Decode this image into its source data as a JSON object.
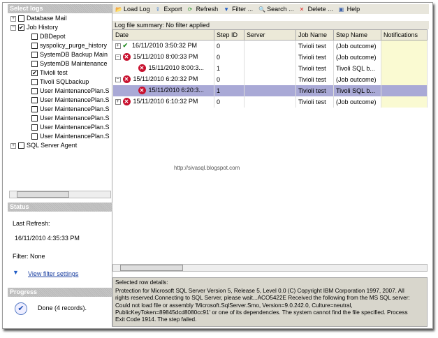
{
  "left": {
    "select_logs": "Select logs",
    "tree": [
      {
        "label": "Database Mail",
        "level": 0,
        "expander": "+",
        "checked": false
      },
      {
        "label": "Job History",
        "level": 0,
        "expander": "-",
        "checked": true
      },
      {
        "label": "DBDepot",
        "level": 1,
        "checked": false
      },
      {
        "label": "syspolicy_purge_history",
        "level": 1,
        "checked": false
      },
      {
        "label": "SystemDB Backup Main",
        "level": 1,
        "checked": false
      },
      {
        "label": "SystemDB Maintenance",
        "level": 1,
        "checked": false
      },
      {
        "label": "Tivioli test",
        "level": 1,
        "checked": true
      },
      {
        "label": "Tivoli SQLbackup",
        "level": 1,
        "checked": false
      },
      {
        "label": "User MaintenancePlan.S",
        "level": 1,
        "checked": false
      },
      {
        "label": "User MaintenancePlan.S",
        "level": 1,
        "checked": false
      },
      {
        "label": "User MaintenancePlan.S",
        "level": 1,
        "checked": false
      },
      {
        "label": "User MaintenancePlan.S",
        "level": 1,
        "checked": false
      },
      {
        "label": "User MaintenancePlan.S",
        "level": 1,
        "checked": false
      },
      {
        "label": "User MaintenancePlan.S",
        "level": 1,
        "checked": false
      },
      {
        "label": "SQL Server Agent",
        "level": 0,
        "expander": "+",
        "checked": false
      }
    ],
    "status": {
      "title": "Status",
      "last_refresh_label": "Last Refresh:",
      "last_refresh": "16/11/2010 4:35:33 PM",
      "filter": "Filter: None",
      "view_filter": "View filter settings"
    },
    "progress": {
      "title": "Progress",
      "text": "Done (4 records)."
    }
  },
  "toolbar": [
    "Load Log",
    "Export",
    "Refresh",
    "Filter ...",
    "Search ...",
    "Delete ...",
    "Help"
  ],
  "summary": "Log file summary: No filter applied",
  "columns": [
    "Date",
    "Step ID",
    "Server",
    "Job Name",
    "Step Name",
    "Notifications"
  ],
  "rows": [
    {
      "exp": "+",
      "status": "success",
      "date": "16/11/2010 3:50:32 PM",
      "step": "0",
      "server": "",
      "job": "Tivioli test",
      "stepname": "(Job outcome)",
      "child": false,
      "selected": false
    },
    {
      "exp": "-",
      "status": "error",
      "date": "15/11/2010 8:00:33 PM",
      "step": "0",
      "server": "",
      "job": "Tivioli test",
      "stepname": "(Job outcome)",
      "child": false,
      "selected": false
    },
    {
      "exp": "",
      "status": "error",
      "date": "15/11/2010 8:00:3...",
      "step": "1",
      "server": "",
      "job": "Tivioli test",
      "stepname": "Tivoli SQL b...",
      "child": true,
      "selected": false
    },
    {
      "exp": "-",
      "status": "error",
      "date": "15/11/2010 6:20:32 PM",
      "step": "0",
      "server": "",
      "job": "Tivioli test",
      "stepname": "(Job outcome)",
      "child": false,
      "selected": false
    },
    {
      "exp": "",
      "status": "error",
      "date": "15/11/2010 6:20:3...",
      "step": "1",
      "server": "",
      "job": "Tivioli test",
      "stepname": "Tivoli SQL b...",
      "child": true,
      "selected": true
    },
    {
      "exp": "+",
      "status": "error",
      "date": "15/11/2010 6:10:32 PM",
      "step": "0",
      "server": "",
      "job": "Tivioli test",
      "stepname": "(Job outcome)",
      "child": false,
      "selected": false
    }
  ],
  "watermark": "http://sivasql.blogspot.com",
  "details": {
    "label": "Selected row details:",
    "text": "Protection for Microsoft SQL Server  Version 5, Release 5, Level 0.0  (C) Copyright IBM Corporation 1997, 2007. All rights reserved.Connecting to SQL Server, please wait...ACO5422E Received the following from the MS SQL server:  Could not load file or assembly 'Microsoft.SqlServer.Smo, Version=9.0.242.0, Culture=neutral, PublicKeyToken=89845dcd8080cc91' or one of its dependencies. The system cannot find the file specified.  Process Exit Code 1914.  The step failed."
  }
}
